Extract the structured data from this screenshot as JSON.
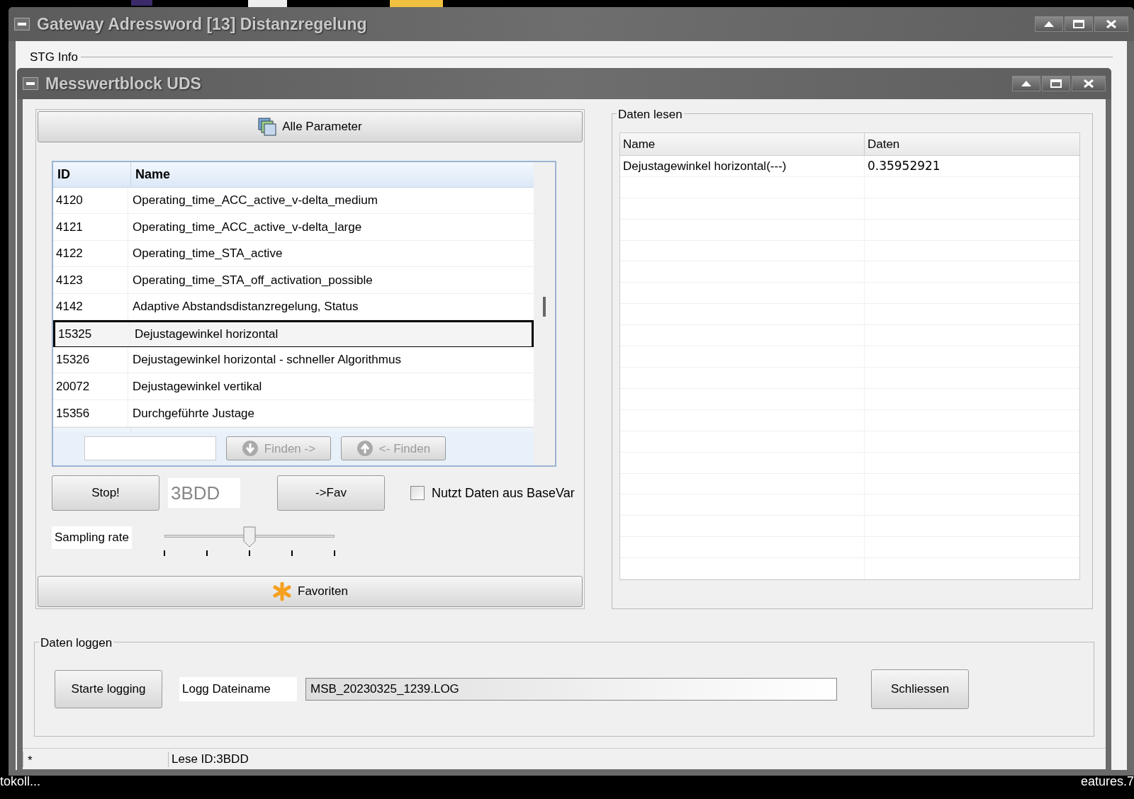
{
  "desktop": {
    "labels": [
      "tokoll...",
      "eatures.7"
    ]
  },
  "outer_window": {
    "title": "Gateway Adressword [13] Distanzregelung",
    "group_title": "STG Info"
  },
  "window": {
    "title": "Messwertblock UDS"
  },
  "all_params_button": "Alle Parameter",
  "table": {
    "columns": [
      "ID",
      "Name"
    ],
    "rows": [
      {
        "id": "4120",
        "name": "Operating_time_ACC_active_v-delta_medium",
        "selected": false
      },
      {
        "id": "4121",
        "name": "Operating_time_ACC_active_v-delta_large",
        "selected": false
      },
      {
        "id": "4122",
        "name": "Operating_time_STA_active",
        "selected": false
      },
      {
        "id": "4123",
        "name": "Operating_time_STA_off_activation_possible",
        "selected": false
      },
      {
        "id": "4142",
        "name": "Adaptive Abstandsdistanzregelung, Status",
        "selected": false
      },
      {
        "id": "15325",
        "name": "Dejustagewinkel horizontal",
        "selected": true
      },
      {
        "id": "15326",
        "name": "Dejustagewinkel horizontal - schneller Algorithmus",
        "selected": false
      },
      {
        "id": "20072",
        "name": "Dejustagewinkel vertikal",
        "selected": false
      },
      {
        "id": "15356",
        "name": "Durchgeführte Justage",
        "selected": false
      }
    ]
  },
  "find_next": "Finden ->",
  "find_prev": "<- Finden",
  "stop_button": "Stop!",
  "id_field": "3BDD",
  "fav_button": "->Fav",
  "basevar_checkbox": {
    "label": "Nutzt Daten aus BaseVar",
    "checked": false
  },
  "sampling": {
    "label": "Sampling rate",
    "level": 0.5
  },
  "favorites_button": "Favoriten",
  "read_group": {
    "title": "Daten lesen",
    "columns": [
      "Name",
      "Daten"
    ],
    "rows": [
      {
        "name": "Dejustagewinkel horizontal(---)",
        "value": "0.35952921"
      }
    ]
  },
  "log_group": {
    "title": "Daten loggen",
    "start_button": "Starte logging",
    "file_label": "Logg Dateiname",
    "file_value": "MSB_20230325_1239.LOG",
    "close_button": "Schliessen"
  },
  "status_bar": [
    "*",
    "Lese ID:3BDD"
  ]
}
